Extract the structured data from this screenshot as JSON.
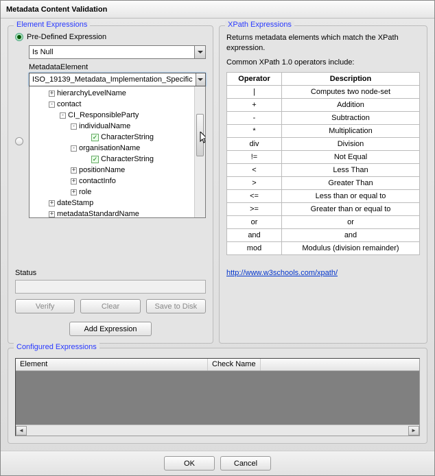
{
  "title": "Metadata Content Validation",
  "left": {
    "legend": "Element Expressions",
    "radio_predefined": "Pre-Defined Expression",
    "predefined_value": "Is Null",
    "metadata_label": "MetadataElement",
    "metadata_value": "ISO_19139_Metadata_Implementation_Specific",
    "tree": {
      "r0": "hierarchyLevelName",
      "r1": "contact",
      "r2": "CI_ResponsibleParty",
      "r3": "individualName",
      "r4": "CharacterString",
      "r5": "organisationName",
      "r6": "CharacterString",
      "r7": "positionName",
      "r8": "contactInfo",
      "r9": "role",
      "r10": "dateStamp",
      "r11": "metadataStandardName"
    },
    "status_label": "Status",
    "btn_verify": "Verify",
    "btn_clear": "Clear",
    "btn_save": "Save to Disk",
    "btn_add": "Add Expression"
  },
  "right": {
    "legend": "XPath Expressions",
    "desc": "Returns metadata elements which match the XPath expression.",
    "common": "Common XPath 1.0 operators include:",
    "th_op": "Operator",
    "th_desc": "Description",
    "rows": [
      {
        "op": "|",
        "desc": "Computes two node-set"
      },
      {
        "op": "+",
        "desc": "Addition"
      },
      {
        "op": "-",
        "desc": "Subtraction"
      },
      {
        "op": "*",
        "desc": "Multiplication"
      },
      {
        "op": "div",
        "desc": "Division"
      },
      {
        "op": "!=",
        "desc": "Not Equal"
      },
      {
        "op": "<",
        "desc": "Less Than"
      },
      {
        "op": ">",
        "desc": "Greater Than"
      },
      {
        "op": "<=",
        "desc": "Less than or equal to"
      },
      {
        "op": ">=",
        "desc": "Greater than or equal to"
      },
      {
        "op": "or",
        "desc": "or"
      },
      {
        "op": "and",
        "desc": "and"
      },
      {
        "op": "mod",
        "desc": "Modulus (division remainder)"
      }
    ],
    "link": "http://www.w3schools.com/xpath/"
  },
  "configured": {
    "legend": "Configured Expressions",
    "col1": "Element",
    "col2": "Check Name"
  },
  "buttons": {
    "ok": "OK",
    "cancel": "Cancel"
  }
}
